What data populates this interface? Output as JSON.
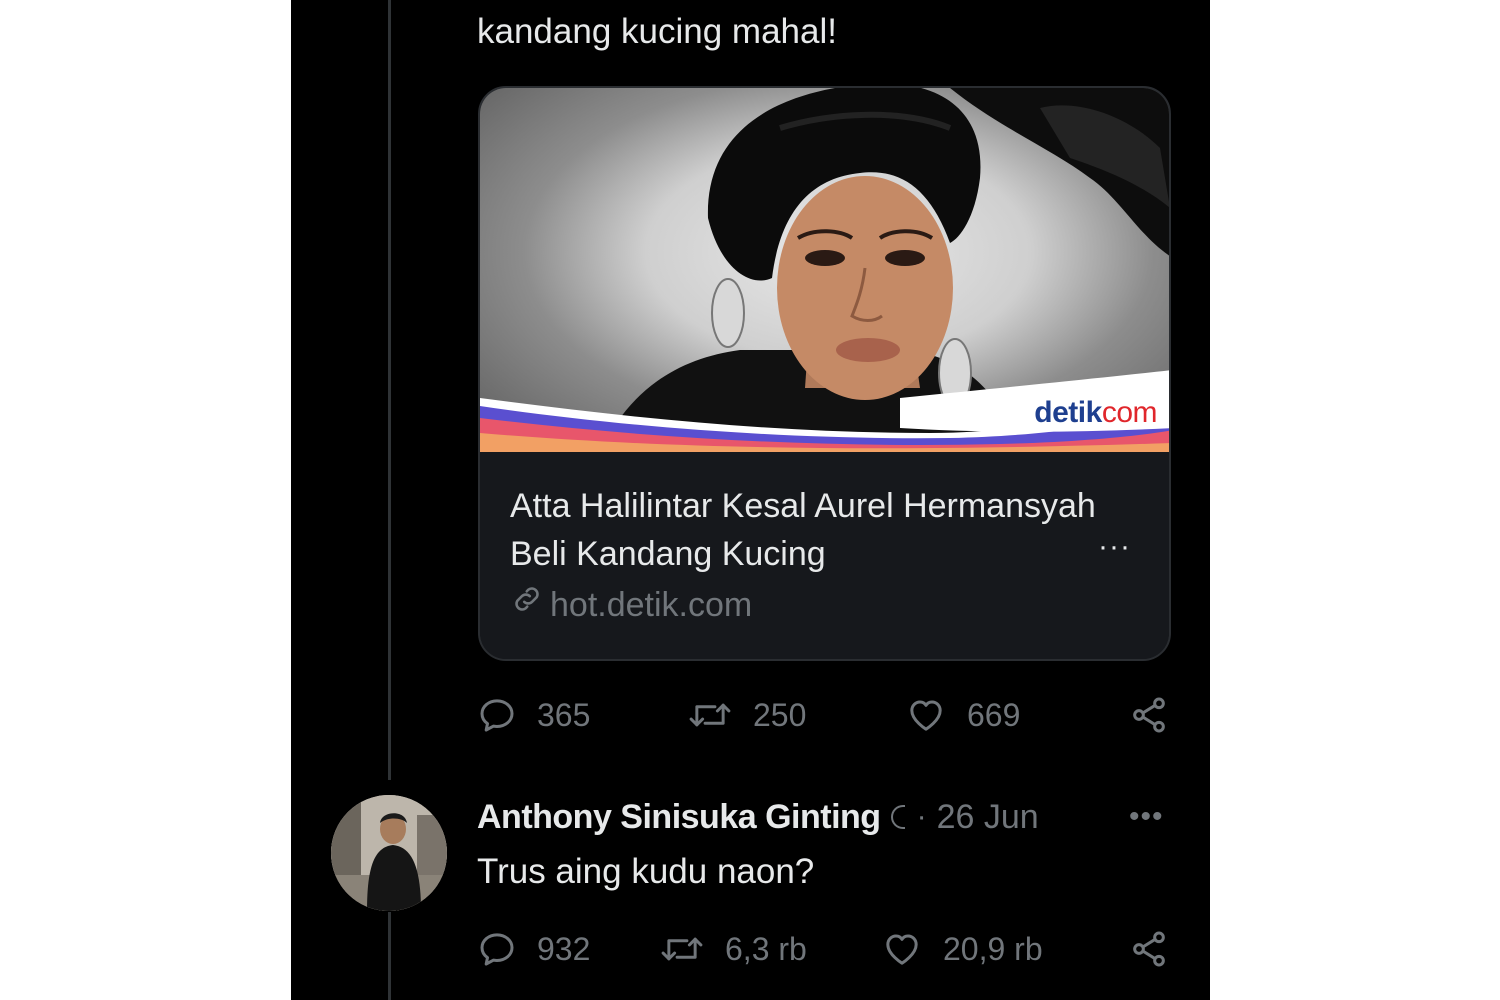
{
  "tweet": {
    "text": "kandang kucing mahal!",
    "link_card": {
      "brand_part1": "detik",
      "brand_part2": "com",
      "title": "Atta Halilintar Kesal Aurel Hermansyah Beli Kandang Kucing",
      "more": "···",
      "domain": "hot.detik.com",
      "domain_icon": "link-icon"
    },
    "actions": {
      "replies": "365",
      "retweets": "250",
      "likes": "669"
    }
  },
  "reply": {
    "name": "Anthony Sinisuka Ginting",
    "separator": "·",
    "date": "26 Jun",
    "more": "•••",
    "text": "Trus aing kudu naon?",
    "actions": {
      "replies": "932",
      "retweets": "6,3 rb",
      "likes": "20,9 rb"
    }
  },
  "colors": {
    "background": "#000000",
    "text": "#e7e9ea",
    "muted": "#71767b",
    "card_bg": "#16181c",
    "detik_blue": "#1e3f8f",
    "detik_red": "#e0262b"
  }
}
